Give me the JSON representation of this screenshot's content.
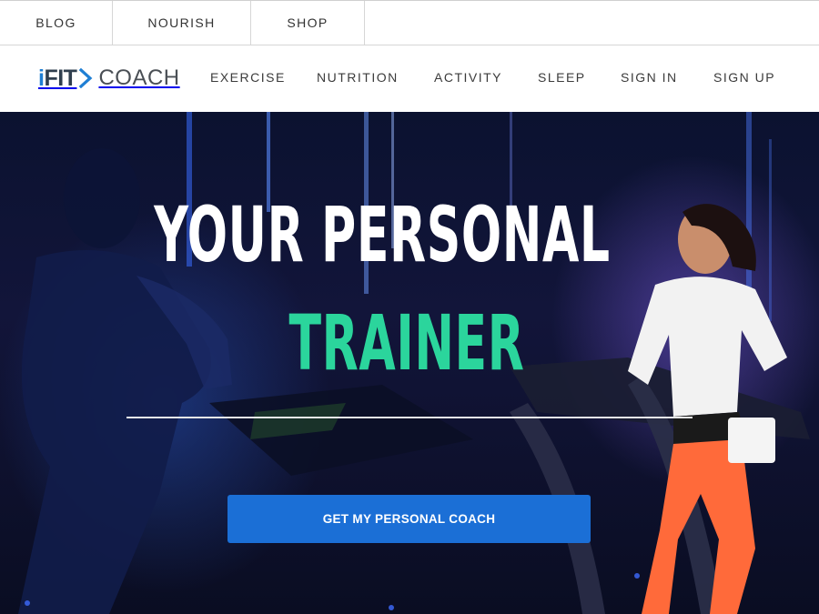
{
  "topbar": {
    "items": [
      {
        "label": "BLOG"
      },
      {
        "label": "NOURISH"
      },
      {
        "label": "SHOP"
      }
    ]
  },
  "logo": {
    "brand": "iFIT",
    "product": "COACH"
  },
  "nav": {
    "items": [
      {
        "label": "EXERCISE"
      },
      {
        "label": "NUTRITION"
      },
      {
        "label": "ACTIVITY"
      },
      {
        "label": "SLEEP"
      },
      {
        "label": "SIGN IN"
      },
      {
        "label": "SIGN UP"
      }
    ]
  },
  "hero": {
    "headline_line1": "YOUR PERSONAL",
    "headline_line2": "TRAINER",
    "cta_label": "GET MY PERSONAL COACH",
    "accent_color": "#2bd59c",
    "button_color": "#1b6fd6"
  }
}
